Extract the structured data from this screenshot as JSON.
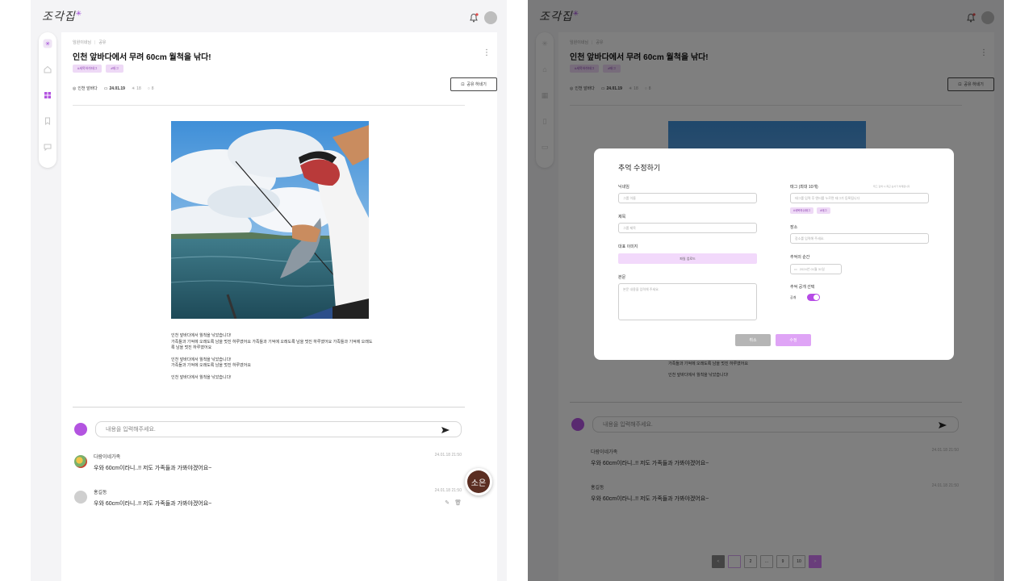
{
  "app": {
    "logo_text": "조각집",
    "logo_spark": "✳"
  },
  "post": {
    "breadcrumb": [
      "임원이네님",
      "공유"
    ],
    "title": "인천 앞바다에서 무려 60cm 월척을 낚다!",
    "tags": [
      "#세목하쉬태그",
      "#태그"
    ],
    "location": "인천 앞바다",
    "date": "24.01.19",
    "views": "18",
    "comments": "8",
    "share_label": "공유 하네기",
    "body": [
      "인천 앞바다에서 월척을 낚았습니다!\n가족들과 기억에 오래도록 남을 멋진 하루였어요 가족들과 기억에 오래도록 남을 멋진 하루였어요 가족들과 기억에 오래도록 남을 멋진 하루였어요",
      "인천 앞바다에서 월척을 낚았습니다!\n가족들과 기억에 오래도록 남을 멋진 하루였어요",
      "인천 앞바다에서 월척을 낚았습니다!"
    ]
  },
  "comment_input": {
    "placeholder": "내용을 입력해주세요."
  },
  "comments": [
    {
      "author": "다람이네가족",
      "time": "24.01.18  21:50",
      "text": "우와 60cm이라니..!! 저도 가족들과 가봐야겠어요~"
    },
    {
      "author": "홍길동",
      "time": "24.01.18  21:50",
      "text": "우와 60cm이라니..!! 저도 가족들과 가봐야겠어요~"
    }
  ],
  "fab": {
    "label": "소은"
  },
  "pagination": {
    "items": [
      "<",
      "",
      "2",
      "...",
      "9",
      "10",
      ">"
    ]
  },
  "modal": {
    "title": "추억 수정하기",
    "nickname_label": "닉네임",
    "nickname_placeholder": "그룹 이름",
    "title_label": "제목",
    "title_placeholder": "그룹 제목",
    "image_label": "대표 이미지",
    "upload_label": "파일 업로드",
    "body_label": "본문",
    "body_placeholder": "본문 내용을 입력해 주세요.",
    "tag_label": "태그 (최대 10개)",
    "tag_hint": "태그 검색 시 최근 순서가 차례됩니다",
    "tag_placeholder": "태그를 입력 후 엔터를 누르면 태그가 등록됩니다",
    "tags": [
      "#세목하쉬태그",
      "#태그"
    ],
    "place_label": "장소",
    "place_placeholder": "장소를 입력해 주세요.",
    "moment_label": "추억의 순간",
    "moment_placeholder": "2024년 01월 31일",
    "public_label": "추억 공개 선택",
    "public_value": "공개",
    "cancel_label": "취소",
    "submit_label": "수정"
  },
  "colors": {
    "accent": "#b354e0",
    "tag_bg": "#eed9f6",
    "pager_accent": "#d37bf6",
    "overlay": "rgba(0,0,0,0.5)"
  }
}
